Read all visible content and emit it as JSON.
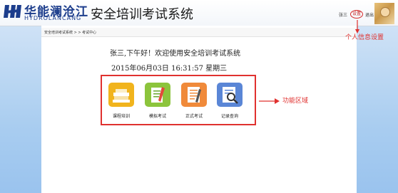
{
  "header": {
    "brand_cn": "华能澜沧江",
    "brand_en": "HYDROLANCANG",
    "title": "安全培训考试系统",
    "user_name": "张三",
    "settings_label": "设置",
    "logout_label": "退出"
  },
  "breadcrumb": {
    "root": "安全培训考试系统",
    "sep": " > > ",
    "current": "考试中心"
  },
  "welcome": {
    "greeting": "张三,下午好！欢迎使用安全培训考试系统",
    "datetime": "2015年06月03日 16:31:57 星期三"
  },
  "functions": [
    {
      "label": "课程培训",
      "icon": "books-icon",
      "color": "#f1b41d"
    },
    {
      "label": "模拟考试",
      "icon": "notebook-icon",
      "color": "#8cc43c"
    },
    {
      "label": "正式考试",
      "icon": "exam-paper-icon",
      "color": "#f08a3a"
    },
    {
      "label": "记录查询",
      "icon": "record-search-icon",
      "color": "#5a86d6"
    }
  ],
  "annotations": {
    "personal_info": "个人信息设置",
    "function_area": "功能区域"
  },
  "colors": {
    "brand": "#1c3d8c",
    "annotation": "#e0312f",
    "side_panel": "#a9cdf0"
  }
}
